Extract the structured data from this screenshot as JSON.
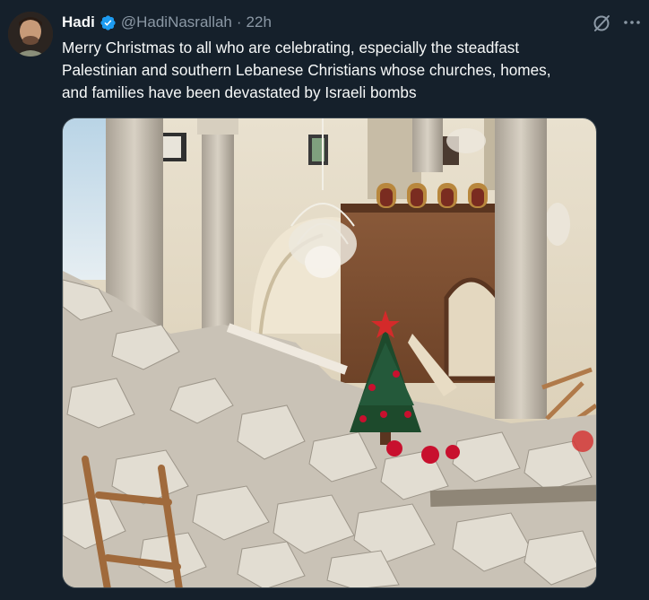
{
  "author": {
    "name": "Hadi",
    "handle": "@HadiNasrallah",
    "separator": "·",
    "time": "22h"
  },
  "tweet": {
    "text_lines": [
      "Merry Christmas to all who are celebrating, especially the steadfast",
      "Palestinian and southern Lebanese Christians whose churches, homes,",
      "and families have been devastated by Israeli bombs"
    ]
  },
  "icons": {
    "verified": "verified-badge-icon",
    "grok": "grok-icon",
    "more": "more-icon"
  },
  "colors": {
    "background": "#15202b",
    "primary_text": "#f7f9f9",
    "secondary_text": "#8b98a5",
    "verified": "#1d9bf0"
  }
}
